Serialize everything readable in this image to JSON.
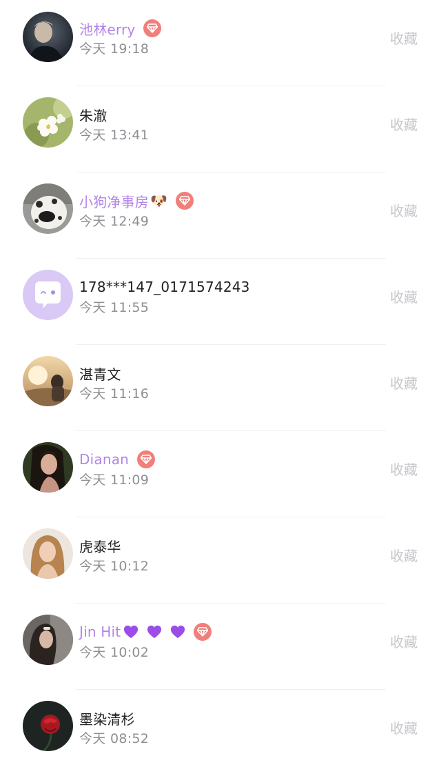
{
  "contacts": [
    {
      "name": "池林erry",
      "vip": true,
      "time": "今天 19:18",
      "action": "收藏",
      "avatar": "man-dark-portrait"
    },
    {
      "name": "朱澈",
      "vip": false,
      "time": "今天 13:41",
      "action": "收藏",
      "avatar": "white-flowers"
    },
    {
      "name": "小狗净事房",
      "emoji": "🐶",
      "vip": true,
      "time": "今天 12:49",
      "action": "收藏",
      "avatar": "dog"
    },
    {
      "name": "178***147_0171574243",
      "vip": false,
      "time": "今天 11:55",
      "action": "收藏",
      "avatar": "default-chat"
    },
    {
      "name": "湛青文",
      "vip": false,
      "time": "今天 11:16",
      "action": "收藏",
      "avatar": "couple-sunset"
    },
    {
      "name": "Dianan",
      "vip": true,
      "time": "今天 11:09",
      "action": "收藏",
      "avatar": "woman-dark-hair"
    },
    {
      "name": "虎泰华",
      "vip": false,
      "time": "今天 10:12",
      "action": "收藏",
      "avatar": "woman-blonde"
    },
    {
      "name": "Jin Hit",
      "hearts": 3,
      "vip": true,
      "time": "今天 10:02",
      "action": "收藏",
      "avatar": "woman-grey"
    },
    {
      "name": "墨染清杉",
      "vip": false,
      "time": "今天 08:52",
      "action": "收藏",
      "avatar": "red-rose"
    }
  ],
  "colors": {
    "vip_name": "#b285e8",
    "vip_badge": "#f07f7b",
    "time": "#8e8e93",
    "action": "#c7c7cc"
  }
}
